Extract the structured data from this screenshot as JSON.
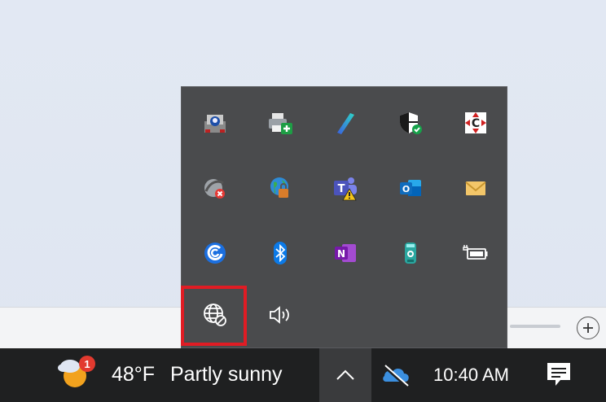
{
  "taskbar": {
    "weather_temp": "48°F",
    "weather_desc": "Partly sunny",
    "weather_badge": "1",
    "clock": "10:40 AM"
  },
  "tray": {
    "icons": [
      {
        "name": "sound-volume-icon",
        "glyph": "speaker"
      }
    ],
    "highlighted": "network-disconnected-icon"
  },
  "colors": {
    "tray_bg": "#4a4b4d",
    "taskbar_bg": "#1f2021",
    "highlight": "#e01c24"
  }
}
